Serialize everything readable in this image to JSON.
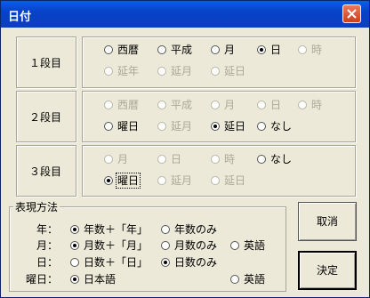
{
  "title": "日付",
  "rows": [
    {
      "label": "１段目",
      "options": [
        {
          "text": "西暦",
          "checked": false,
          "disabled": false
        },
        {
          "text": "平成",
          "checked": false,
          "disabled": false
        },
        {
          "text": "月",
          "checked": false,
          "disabled": false
        },
        {
          "text": "日",
          "checked": true,
          "disabled": false
        },
        {
          "text": "時",
          "checked": false,
          "disabled": true
        },
        {
          "text": "延年",
          "checked": false,
          "disabled": true
        },
        {
          "text": "延月",
          "checked": false,
          "disabled": true
        },
        {
          "text": "延日",
          "checked": false,
          "disabled": true
        }
      ]
    },
    {
      "label": "２段目",
      "options": [
        {
          "text": "西暦",
          "checked": false,
          "disabled": true
        },
        {
          "text": "平成",
          "checked": false,
          "disabled": true
        },
        {
          "text": "月",
          "checked": false,
          "disabled": true
        },
        {
          "text": "日",
          "checked": false,
          "disabled": true
        },
        {
          "text": "時",
          "checked": false,
          "disabled": true
        },
        {
          "text": "曜日",
          "checked": false,
          "disabled": false
        },
        {
          "text": "延月",
          "checked": false,
          "disabled": true
        },
        {
          "text": "延日",
          "checked": true,
          "disabled": false
        },
        {
          "text": "なし",
          "checked": false,
          "disabled": false
        }
      ]
    },
    {
      "label": "３段目",
      "options": [
        {
          "text": "月",
          "checked": false,
          "disabled": true
        },
        {
          "text": "日",
          "checked": false,
          "disabled": true
        },
        {
          "text": "時",
          "checked": false,
          "disabled": true
        },
        {
          "text": "なし",
          "checked": false,
          "disabled": false
        },
        {
          "text": "曜日",
          "checked": true,
          "disabled": false
        },
        {
          "text": "延月",
          "checked": false,
          "disabled": true
        },
        {
          "text": "延日",
          "checked": false,
          "disabled": true
        }
      ]
    }
  ],
  "expression": {
    "title": "表現方法",
    "year_label": "年：",
    "year_opts": [
      "年数＋「年」",
      "年数のみ"
    ],
    "month_label": "月：",
    "month_opts": [
      "月数＋「月」",
      "月数のみ",
      "英語"
    ],
    "day_label": "日：",
    "day_opts": [
      "日数＋「日」",
      "日数のみ"
    ],
    "weekday_label": "曜日：",
    "weekday_opts": [
      "日本語",
      "英語"
    ]
  },
  "buttons": {
    "cancel": "取消",
    "ok": "決定"
  }
}
